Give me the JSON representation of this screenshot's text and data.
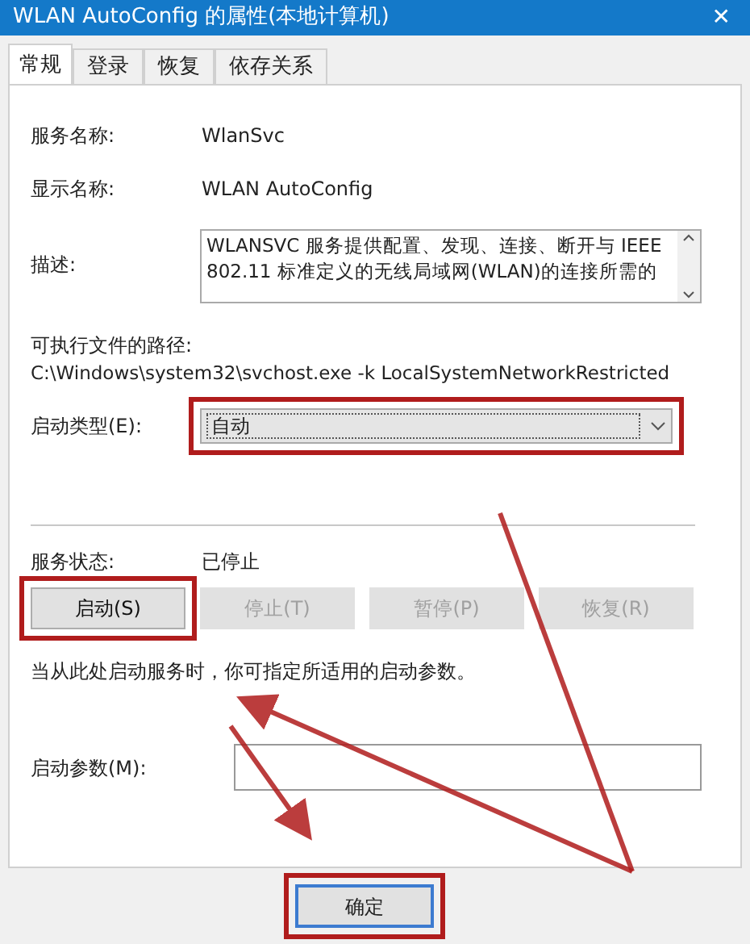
{
  "window": {
    "title": "WLAN AutoConfig 的属性(本地计算机)",
    "close": "✕"
  },
  "tabs": [
    {
      "label": "常规",
      "selected": true
    },
    {
      "label": "登录",
      "selected": false
    },
    {
      "label": "恢复",
      "selected": false
    },
    {
      "label": "依存关系",
      "selected": false
    }
  ],
  "service_name": {
    "label": "服务名称:",
    "value": "WlanSvc"
  },
  "display_name": {
    "label": "显示名称:",
    "value": "WLAN AutoConfig"
  },
  "description": {
    "label": "描述:",
    "value": "WLANSVC 服务提供配置、发现、连接、断开与 IEEE 802.11 标准定义的无线局域网(WLAN)的连接所需的"
  },
  "executable_path": {
    "label": "可执行文件的路径:",
    "value": "C:\\Windows\\system32\\svchost.exe -k LocalSystemNetworkRestricted"
  },
  "startup_type": {
    "label": "启动类型(E):",
    "value": "自动",
    "highlighted": true
  },
  "service_status": {
    "label": "服务状态:",
    "value": "已停止"
  },
  "service_buttons": [
    {
      "label": "启动(S)",
      "disabled": false,
      "highlighted": true
    },
    {
      "label": "停止(T)",
      "disabled": true,
      "highlighted": false
    },
    {
      "label": "暂停(P)",
      "disabled": true,
      "highlighted": false
    },
    {
      "label": "恢复(R)",
      "disabled": true,
      "highlighted": false
    }
  ],
  "hint": "当从此处启动服务时，你可指定所适用的启动参数。",
  "start_parameters": {
    "label": "启动参数(M):"
  },
  "ok_button": {
    "label": "确定",
    "highlighted": true
  }
}
